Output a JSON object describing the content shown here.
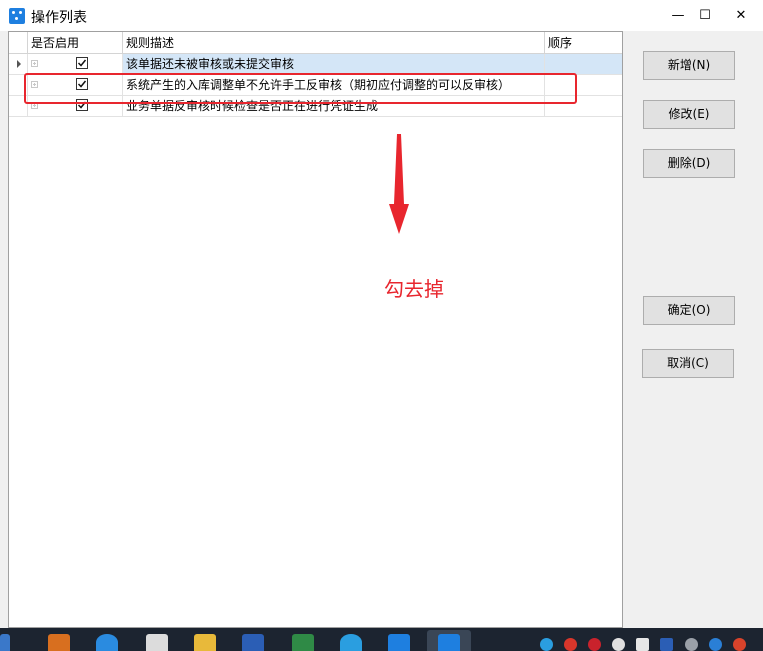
{
  "window": {
    "title": "操作列表",
    "minimize_glyph": "—",
    "maximize_glyph": "☐",
    "close_glyph": "✕"
  },
  "grid": {
    "columns": [
      "是否启用",
      "规则描述",
      "顺序"
    ],
    "rows": [
      {
        "enabled": true,
        "description": "该单据还未被审核或未提交审核",
        "order": "",
        "selected": true
      },
      {
        "enabled": true,
        "description": "系统产生的入库调整单不允许手工反审核（期初应付调整的可以反审核）",
        "order": "",
        "selected": false
      },
      {
        "enabled": true,
        "description": "业务单据反审核时候检查是否正在进行凭证生成",
        "order": "",
        "selected": false
      }
    ]
  },
  "buttons": {
    "new": "新增(N)",
    "modify": "修改(E)",
    "delete": "删除(D)",
    "ok": "确定(O)",
    "cancel": "取消(C)"
  },
  "annotation": {
    "text": "勾去掉"
  },
  "colors": {
    "selected_row": "#d4e6f7",
    "annotation_red": "#e8262e",
    "taskbar": "#1c2430"
  },
  "taskbar_icons": [
    "sublime-icon",
    "sogou-icon",
    "notepad-icon",
    "folder-icon",
    "word-icon",
    "excel-icon",
    "feather-icon",
    "app-icon",
    "app-icon-active"
  ],
  "tray_icons": [
    "tray-icon-1",
    "tray-icon-2",
    "netease-music-icon",
    "tray-icon-4",
    "shield-icon",
    "word-tray-icon",
    "tray-icon-7",
    "bluetooth-icon",
    "tray-icon-9"
  ]
}
